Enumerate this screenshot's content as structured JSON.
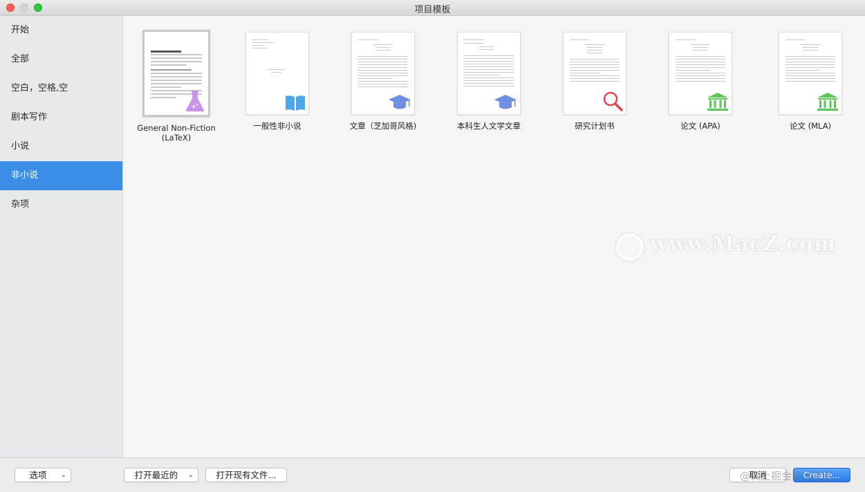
{
  "window": {
    "title": "项目模板"
  },
  "sidebar": {
    "items": [
      {
        "label": "开始"
      },
      {
        "label": "全部"
      },
      {
        "label": "空白，空格,空"
      },
      {
        "label": "剧本写作"
      },
      {
        "label": "小说"
      },
      {
        "label": "非小说",
        "active": true
      },
      {
        "label": "杂项"
      }
    ]
  },
  "templates": [
    {
      "label_line1": "General Non-Fiction",
      "label_line2": "(LaTeX)",
      "icon": "flask-icon",
      "selected": true
    },
    {
      "label_line1": "一般性非小说",
      "label_line2": "",
      "icon": "book-icon"
    },
    {
      "label_line1": "文章（芝加哥风格)",
      "label_line2": "",
      "icon": "graduation-cap-icon"
    },
    {
      "label_line1": "本科生人文学文章",
      "label_line2": "",
      "icon": "graduation-cap-icon"
    },
    {
      "label_line1": "研究计划书",
      "label_line2": "",
      "icon": "magnifier-icon"
    },
    {
      "label_line1": "论文 (APA)",
      "label_line2": "",
      "icon": "institution-icon"
    },
    {
      "label_line1": "论文 (MLA)",
      "label_line2": "",
      "icon": "institution-icon"
    }
  ],
  "watermark": {
    "text": "www.MacZ.com"
  },
  "footer": {
    "options_label": "选项",
    "recent_label": "打开最近的",
    "open_existing_label": "打开现有文件...",
    "cancel_label": "取消",
    "create_label": "Create...",
    "signature": "@稀土掘金技术社区"
  },
  "colors": {
    "accent": "#3a8ee6",
    "flask": "#c993e8",
    "book": "#4da6e8",
    "cap": "#6f8fe0",
    "magnifier": "#e0474c",
    "institution": "#5cc45a"
  }
}
